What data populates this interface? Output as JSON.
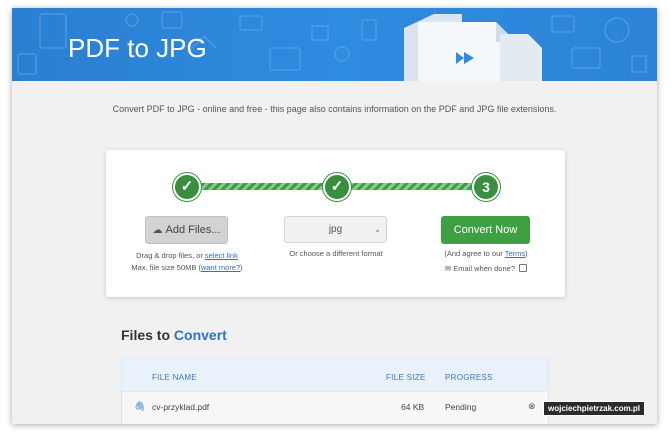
{
  "hero": {
    "title": "PDF to JPG"
  },
  "intro": {
    "text": "Convert PDF to JPG - online and free - this page also contains information on the PDF and JPG file extensions."
  },
  "steps": {
    "step1": "✓",
    "step2": "✓",
    "step3": "3"
  },
  "upload": {
    "add_files_label": "Add Files...",
    "drag_text_prefix": "Drag & drop files, or",
    "select_link": "select link",
    "max_size_prefix": "Max. file size 50MB",
    "want_more": "want more?"
  },
  "format": {
    "selected": "jpg",
    "caption": "Or choose a different format"
  },
  "convert": {
    "button_label": "Convert Now",
    "agree_prefix": "(And agree to our",
    "terms_link": "Terms",
    "agree_suffix": ")",
    "email_label": "Email when done?"
  },
  "files": {
    "heading_prefix": "Files to",
    "heading_accent": "Convert",
    "columns": {
      "name": "FILE NAME",
      "size": "FILE SIZE",
      "status": "PROGRESS"
    },
    "rows": [
      {
        "name": "cv-przyklad.pdf",
        "size": "64 KB",
        "status": "Pending"
      }
    ]
  },
  "watermark": "wojciechpietrzak.com.pl",
  "colors": {
    "hero": "#2f8be0",
    "accent_green": "#3fa043",
    "link_blue": "#2b74c7"
  },
  "icons": [
    "upload-cloud-icon",
    "chevron-down-icon",
    "envelope-icon",
    "paperclip-icon",
    "remove-icon",
    "check-icon"
  ]
}
